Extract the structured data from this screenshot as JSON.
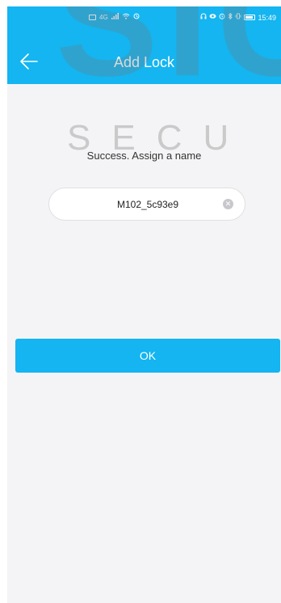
{
  "status_bar": {
    "time": "15:49",
    "network": "4G",
    "icons_left": [
      "sim-icon",
      "signal-icon",
      "wifi-icon",
      "data-sync-icon"
    ],
    "icons_right": [
      "headset-icon",
      "eye-icon",
      "alarm-icon",
      "bluetooth-icon",
      "vibrate-icon",
      "battery-icon"
    ]
  },
  "header": {
    "title": "Add Lock",
    "background": "#14b5f0"
  },
  "watermark": {
    "large": "SIC",
    "small": "SECU"
  },
  "main": {
    "prompt": "Success. Assign a name",
    "name_field": {
      "value": "M102_5c93e9",
      "placeholder": ""
    },
    "ok_button": {
      "label": "OK"
    }
  },
  "colors": {
    "accent": "#14b5f0",
    "background": "#f4f4f6"
  }
}
